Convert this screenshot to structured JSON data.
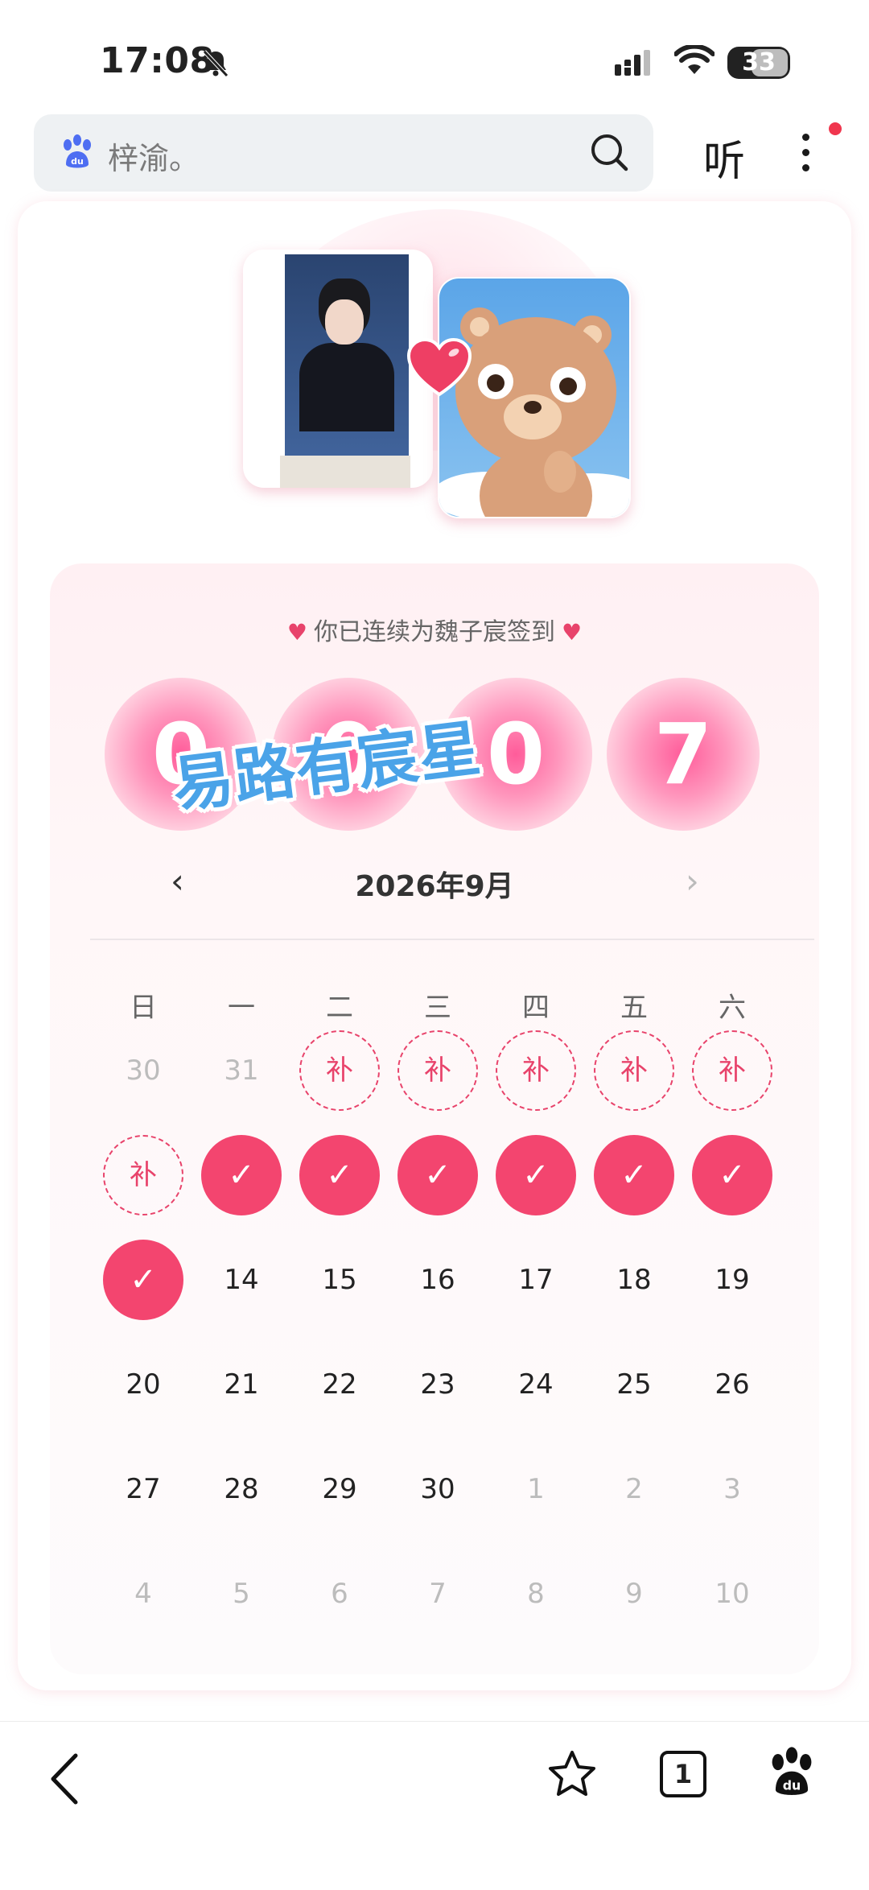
{
  "status_bar": {
    "time": "17:08",
    "battery": "33",
    "icons": [
      "bell-slash-icon",
      "signal-icon",
      "wifi-icon",
      "battery-icon"
    ]
  },
  "search_bar": {
    "query": "梓渝。",
    "listen_label": "听",
    "icons": [
      "baidu-paw-icon",
      "search-icon",
      "more-icon"
    ]
  },
  "checkin": {
    "title": "你已连续为魏子宸签到",
    "digits": [
      "0",
      "0",
      "0",
      "7"
    ],
    "overlay_text": "易路有宸星",
    "month_title": "2026年9月",
    "prev": "‹",
    "next": "›",
    "weekdays": [
      "日",
      "一",
      "二",
      "三",
      "四",
      "五",
      "六"
    ],
    "buqian_label": "补",
    "check_mark": "✓",
    "weeks": [
      [
        {
          "t": "30",
          "s": "muted"
        },
        {
          "t": "31",
          "s": "muted"
        },
        {
          "t": "补",
          "s": "buqian"
        },
        {
          "t": "补",
          "s": "buqian"
        },
        {
          "t": "补",
          "s": "buqian"
        },
        {
          "t": "补",
          "s": "buqian"
        },
        {
          "t": "补",
          "s": "buqian"
        }
      ],
      [
        {
          "t": "补",
          "s": "buqian"
        },
        {
          "t": "✓",
          "s": "checked"
        },
        {
          "t": "✓",
          "s": "checked"
        },
        {
          "t": "✓",
          "s": "checked"
        },
        {
          "t": "✓",
          "s": "checked"
        },
        {
          "t": "✓",
          "s": "checked"
        },
        {
          "t": "✓",
          "s": "checked"
        }
      ],
      [
        {
          "t": "✓",
          "s": "checked"
        },
        {
          "t": "14",
          "s": "normal"
        },
        {
          "t": "15",
          "s": "normal"
        },
        {
          "t": "16",
          "s": "normal"
        },
        {
          "t": "17",
          "s": "normal"
        },
        {
          "t": "18",
          "s": "normal"
        },
        {
          "t": "19",
          "s": "normal"
        }
      ],
      [
        {
          "t": "20",
          "s": "normal"
        },
        {
          "t": "21",
          "s": "normal"
        },
        {
          "t": "22",
          "s": "normal"
        },
        {
          "t": "23",
          "s": "normal"
        },
        {
          "t": "24",
          "s": "normal"
        },
        {
          "t": "25",
          "s": "normal"
        },
        {
          "t": "26",
          "s": "normal"
        }
      ],
      [
        {
          "t": "27",
          "s": "normal"
        },
        {
          "t": "28",
          "s": "normal"
        },
        {
          "t": "29",
          "s": "normal"
        },
        {
          "t": "30",
          "s": "normal"
        },
        {
          "t": "1",
          "s": "muted"
        },
        {
          "t": "2",
          "s": "muted"
        },
        {
          "t": "3",
          "s": "muted"
        }
      ],
      [
        {
          "t": "4",
          "s": "muted"
        },
        {
          "t": "5",
          "s": "muted"
        },
        {
          "t": "6",
          "s": "muted"
        },
        {
          "t": "7",
          "s": "muted"
        },
        {
          "t": "8",
          "s": "muted"
        },
        {
          "t": "9",
          "s": "muted"
        },
        {
          "t": "10",
          "s": "muted"
        }
      ]
    ]
  },
  "bottom_bar": {
    "tab_count": "1",
    "icons": [
      "back-icon",
      "star-icon",
      "tabs-icon",
      "baidu-du-icon"
    ]
  },
  "colors": {
    "accent": "#f3456f",
    "digit_glow": "#ff5c9a",
    "overlay_blue": "#4aa3e8"
  }
}
